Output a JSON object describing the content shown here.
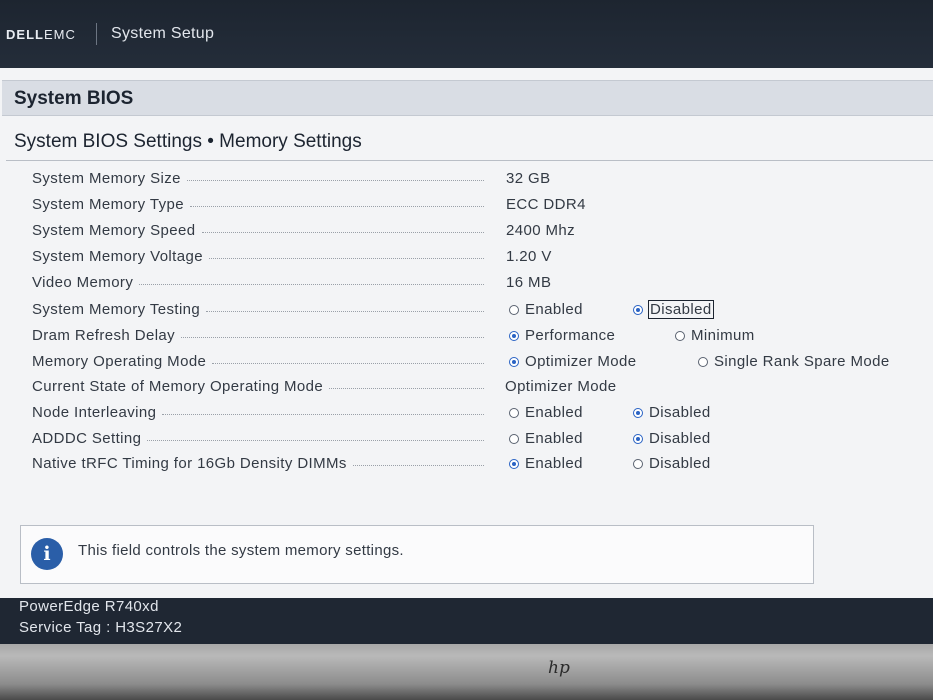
{
  "header": {
    "brand_bold": "D",
    "brand_e": "E",
    "brand_ll": "LL",
    "brand_emc": "EMC",
    "title": "System Setup"
  },
  "section": {
    "title": "System BIOS"
  },
  "page": {
    "breadcrumb": "System BIOS Settings • Memory Settings"
  },
  "settings": [
    {
      "label": "System Memory Size",
      "value": "32 GB"
    },
    {
      "label": "System Memory Type",
      "value": "ECC DDR4"
    },
    {
      "label": "System Memory Speed",
      "value": "2400 Mhz"
    },
    {
      "label": "System Memory Voltage",
      "value": "1.20 V"
    },
    {
      "label": "Video Memory",
      "value": "16 MB"
    },
    {
      "label": "System Memory Testing",
      "options": [
        "Enabled",
        "Disabled"
      ],
      "selected": "Disabled"
    },
    {
      "label": "Dram Refresh Delay",
      "options": [
        "Performance",
        "Minimum"
      ],
      "selected": "Performance"
    },
    {
      "label": "Memory Operating Mode",
      "options": [
        "Optimizer Mode",
        "Single Rank Spare Mode"
      ],
      "selected": "Optimizer Mode"
    },
    {
      "label": "Current State of Memory Operating Mode",
      "value": "Optimizer Mode"
    },
    {
      "label": "Node Interleaving",
      "options": [
        "Enabled",
        "Disabled"
      ],
      "selected": "Disabled"
    },
    {
      "label": "ADDDC Setting",
      "options": [
        "Enabled",
        "Disabled"
      ],
      "selected": "Disabled"
    },
    {
      "label": "Native tRFC Timing for 16Gb Density DIMMs",
      "options": [
        "Enabled",
        "Disabled"
      ],
      "selected": "Enabled"
    }
  ],
  "help": {
    "icon": "info-icon",
    "glyph": "i",
    "text": "This field controls the system memory settings."
  },
  "footer": {
    "model": "PowerEdge R740xd",
    "service_tag": "Service Tag : H3S27X2"
  },
  "bezel": {
    "logo": "hp"
  },
  "colors": {
    "header_bg": "#1f2733",
    "radio_on": "#2a63c4",
    "section_bg": "#d9dde4"
  }
}
